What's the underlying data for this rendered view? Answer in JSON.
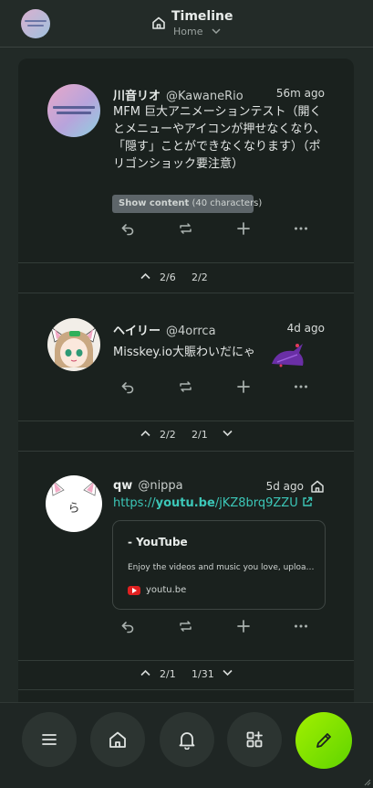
{
  "header": {
    "title": "Timeline",
    "subtitle": "Home"
  },
  "notes": [
    {
      "display_name": "川音リオ",
      "username": "@KawaneRio",
      "time": "56m ago",
      "text": " MFM 巨大アニメーションテスト（開くとメニューやアイコンが押せなくなり、「隠す」ことができなくなります）（ポリゴンショック要注意）",
      "cw_label": "Show content",
      "cw_count": "(40 characters)"
    },
    {
      "display_name": "ヘイリー",
      "username": "@4orrca",
      "time": "4d ago",
      "text": "Misskey.io大賑わいだにゃ"
    },
    {
      "display_name": "qw",
      "username": "@nippa",
      "time": "5d ago",
      "avatar_glyph": "ら",
      "link_prefix": "https://",
      "link_domain": "youtu.be",
      "link_path": "/jKZ8brq9ZZU",
      "preview": {
        "title": "- YouTube",
        "description": "Enjoy the videos and music you love, upload original content, and share it all with friends",
        "site": "youtu.be"
      }
    }
  ],
  "pagers": [
    {
      "a": "2/6",
      "b": "2/2"
    },
    {
      "a": "2/2",
      "b": "2/1"
    },
    {
      "a": "2/1",
      "b": "1/31"
    }
  ],
  "icons": {
    "reply": "reply-icon",
    "renote": "renote-icon",
    "react": "plus-icon",
    "more": "more-icon",
    "menu": "menu-icon",
    "home": "home-icon",
    "bell": "bell-icon",
    "widgets": "widgets-icon",
    "post": "pencil-icon"
  },
  "colors": {
    "accent": "#86e600",
    "link": "#3cc7b8",
    "background": "#222a27",
    "card": "#1a211e"
  }
}
